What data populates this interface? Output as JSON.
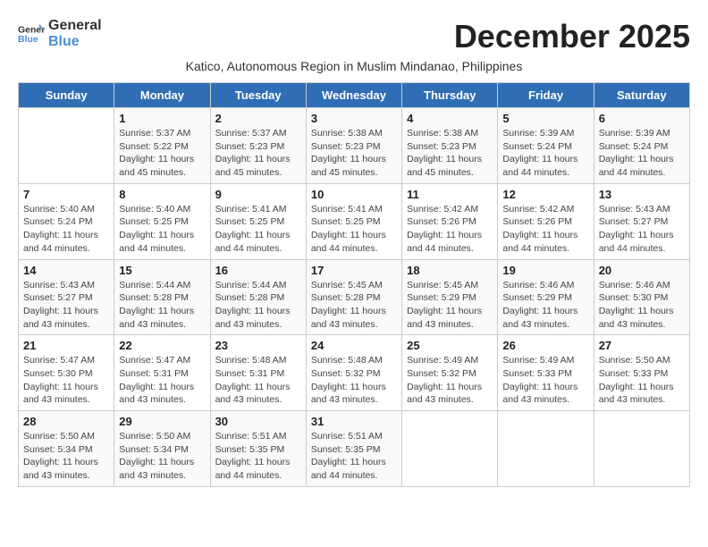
{
  "logo": {
    "general": "General",
    "blue": "Blue"
  },
  "title": "December 2025",
  "subtitle": "Katico, Autonomous Region in Muslim Mindanao, Philippines",
  "weekdays": [
    "Sunday",
    "Monday",
    "Tuesday",
    "Wednesday",
    "Thursday",
    "Friday",
    "Saturday"
  ],
  "weeks": [
    [
      {
        "day": "",
        "info": ""
      },
      {
        "day": "1",
        "info": "Sunrise: 5:37 AM\nSunset: 5:22 PM\nDaylight: 11 hours\nand 45 minutes."
      },
      {
        "day": "2",
        "info": "Sunrise: 5:37 AM\nSunset: 5:23 PM\nDaylight: 11 hours\nand 45 minutes."
      },
      {
        "day": "3",
        "info": "Sunrise: 5:38 AM\nSunset: 5:23 PM\nDaylight: 11 hours\nand 45 minutes."
      },
      {
        "day": "4",
        "info": "Sunrise: 5:38 AM\nSunset: 5:23 PM\nDaylight: 11 hours\nand 45 minutes."
      },
      {
        "day": "5",
        "info": "Sunrise: 5:39 AM\nSunset: 5:24 PM\nDaylight: 11 hours\nand 44 minutes."
      },
      {
        "day": "6",
        "info": "Sunrise: 5:39 AM\nSunset: 5:24 PM\nDaylight: 11 hours\nand 44 minutes."
      }
    ],
    [
      {
        "day": "7",
        "info": "Sunrise: 5:40 AM\nSunset: 5:24 PM\nDaylight: 11 hours\nand 44 minutes."
      },
      {
        "day": "8",
        "info": "Sunrise: 5:40 AM\nSunset: 5:25 PM\nDaylight: 11 hours\nand 44 minutes."
      },
      {
        "day": "9",
        "info": "Sunrise: 5:41 AM\nSunset: 5:25 PM\nDaylight: 11 hours\nand 44 minutes."
      },
      {
        "day": "10",
        "info": "Sunrise: 5:41 AM\nSunset: 5:25 PM\nDaylight: 11 hours\nand 44 minutes."
      },
      {
        "day": "11",
        "info": "Sunrise: 5:42 AM\nSunset: 5:26 PM\nDaylight: 11 hours\nand 44 minutes."
      },
      {
        "day": "12",
        "info": "Sunrise: 5:42 AM\nSunset: 5:26 PM\nDaylight: 11 hours\nand 44 minutes."
      },
      {
        "day": "13",
        "info": "Sunrise: 5:43 AM\nSunset: 5:27 PM\nDaylight: 11 hours\nand 44 minutes."
      }
    ],
    [
      {
        "day": "14",
        "info": "Sunrise: 5:43 AM\nSunset: 5:27 PM\nDaylight: 11 hours\nand 43 minutes."
      },
      {
        "day": "15",
        "info": "Sunrise: 5:44 AM\nSunset: 5:28 PM\nDaylight: 11 hours\nand 43 minutes."
      },
      {
        "day": "16",
        "info": "Sunrise: 5:44 AM\nSunset: 5:28 PM\nDaylight: 11 hours\nand 43 minutes."
      },
      {
        "day": "17",
        "info": "Sunrise: 5:45 AM\nSunset: 5:28 PM\nDaylight: 11 hours\nand 43 minutes."
      },
      {
        "day": "18",
        "info": "Sunrise: 5:45 AM\nSunset: 5:29 PM\nDaylight: 11 hours\nand 43 minutes."
      },
      {
        "day": "19",
        "info": "Sunrise: 5:46 AM\nSunset: 5:29 PM\nDaylight: 11 hours\nand 43 minutes."
      },
      {
        "day": "20",
        "info": "Sunrise: 5:46 AM\nSunset: 5:30 PM\nDaylight: 11 hours\nand 43 minutes."
      }
    ],
    [
      {
        "day": "21",
        "info": "Sunrise: 5:47 AM\nSunset: 5:30 PM\nDaylight: 11 hours\nand 43 minutes."
      },
      {
        "day": "22",
        "info": "Sunrise: 5:47 AM\nSunset: 5:31 PM\nDaylight: 11 hours\nand 43 minutes."
      },
      {
        "day": "23",
        "info": "Sunrise: 5:48 AM\nSunset: 5:31 PM\nDaylight: 11 hours\nand 43 minutes."
      },
      {
        "day": "24",
        "info": "Sunrise: 5:48 AM\nSunset: 5:32 PM\nDaylight: 11 hours\nand 43 minutes."
      },
      {
        "day": "25",
        "info": "Sunrise: 5:49 AM\nSunset: 5:32 PM\nDaylight: 11 hours\nand 43 minutes."
      },
      {
        "day": "26",
        "info": "Sunrise: 5:49 AM\nSunset: 5:33 PM\nDaylight: 11 hours\nand 43 minutes."
      },
      {
        "day": "27",
        "info": "Sunrise: 5:50 AM\nSunset: 5:33 PM\nDaylight: 11 hours\nand 43 minutes."
      }
    ],
    [
      {
        "day": "28",
        "info": "Sunrise: 5:50 AM\nSunset: 5:34 PM\nDaylight: 11 hours\nand 43 minutes."
      },
      {
        "day": "29",
        "info": "Sunrise: 5:50 AM\nSunset: 5:34 PM\nDaylight: 11 hours\nand 43 minutes."
      },
      {
        "day": "30",
        "info": "Sunrise: 5:51 AM\nSunset: 5:35 PM\nDaylight: 11 hours\nand 44 minutes."
      },
      {
        "day": "31",
        "info": "Sunrise: 5:51 AM\nSunset: 5:35 PM\nDaylight: 11 hours\nand 44 minutes."
      },
      {
        "day": "",
        "info": ""
      },
      {
        "day": "",
        "info": ""
      },
      {
        "day": "",
        "info": ""
      }
    ]
  ]
}
